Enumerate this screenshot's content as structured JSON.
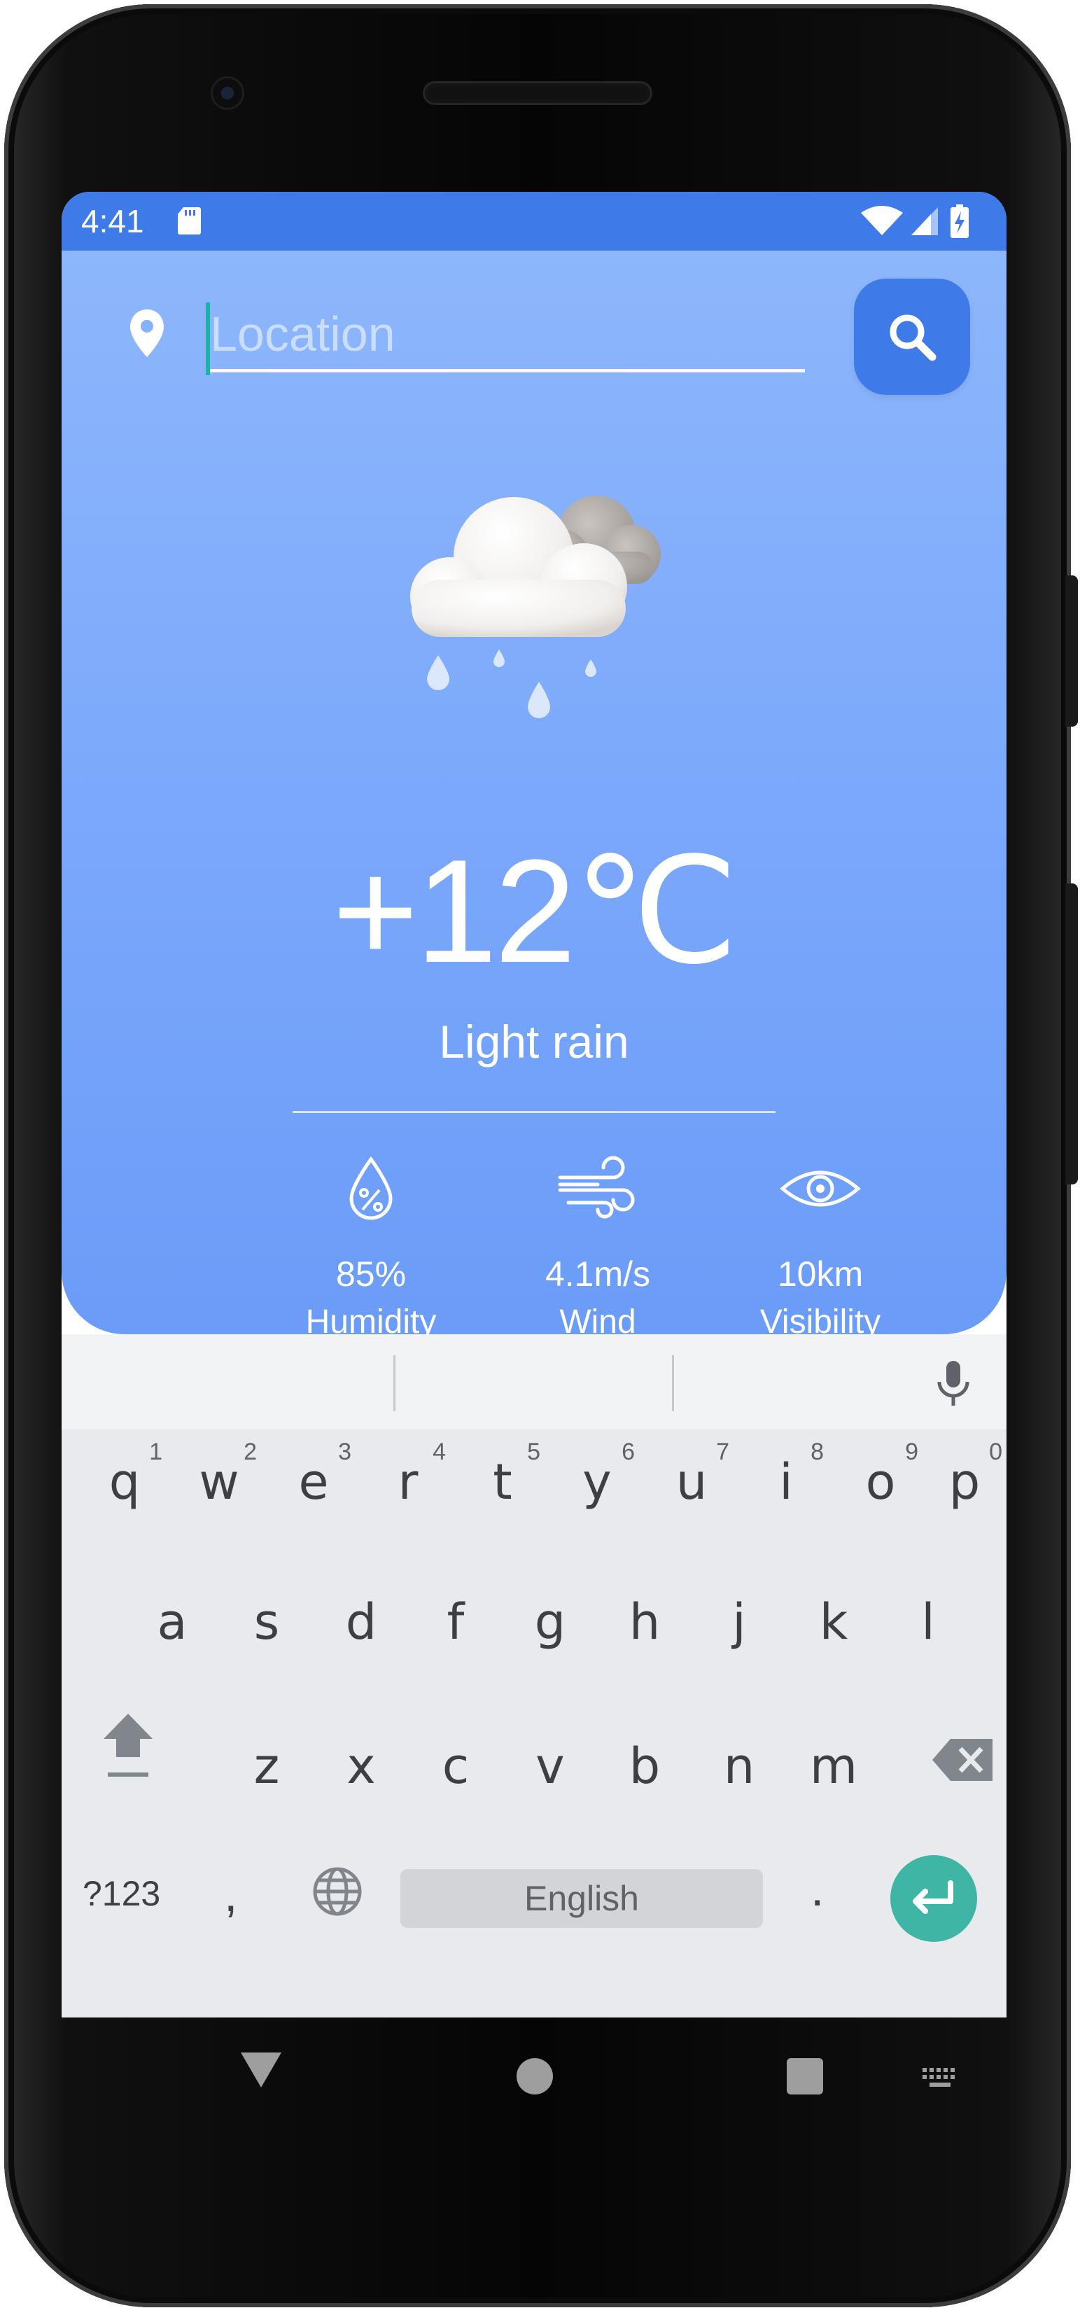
{
  "status_bar": {
    "time": "4:41",
    "icons": [
      "sd-card-icon",
      "wifi-icon",
      "cell-signal-icon",
      "battery-charging-icon"
    ]
  },
  "search": {
    "placeholder": "Location",
    "value": "",
    "icon": "search-icon"
  },
  "weather": {
    "icon": "cloud-rain-icon",
    "temperature": "+12℃",
    "condition": "Light rain",
    "metrics": [
      {
        "icon": "humidity-drop-icon",
        "value": "85%",
        "label": "Humidity"
      },
      {
        "icon": "wind-icon",
        "value": "4.1m/s",
        "label": "Wind"
      },
      {
        "icon": "eye-icon",
        "value": "10km",
        "label": "Visibility"
      }
    ]
  },
  "keyboard": {
    "row1": [
      {
        "key": "q",
        "hint": "1"
      },
      {
        "key": "w",
        "hint": "2"
      },
      {
        "key": "e",
        "hint": "3"
      },
      {
        "key": "r",
        "hint": "4"
      },
      {
        "key": "t",
        "hint": "5"
      },
      {
        "key": "y",
        "hint": "6"
      },
      {
        "key": "u",
        "hint": "7"
      },
      {
        "key": "i",
        "hint": "8"
      },
      {
        "key": "o",
        "hint": "9"
      },
      {
        "key": "p",
        "hint": "0"
      }
    ],
    "row2": [
      "a",
      "s",
      "d",
      "f",
      "g",
      "h",
      "j",
      "k",
      "l"
    ],
    "row3": [
      "z",
      "x",
      "c",
      "v",
      "b",
      "n",
      "m"
    ],
    "symbols_label": "?123",
    "comma": ",",
    "period": ".",
    "space_label": "English"
  },
  "colors": {
    "status_bar": "#3f7be8",
    "card_top": "#8db6fb",
    "card_bottom": "#6a9cf8",
    "search_button": "#3f7be8",
    "enter_key": "#3fb5a5",
    "keyboard_bg": "#e8eaed"
  }
}
